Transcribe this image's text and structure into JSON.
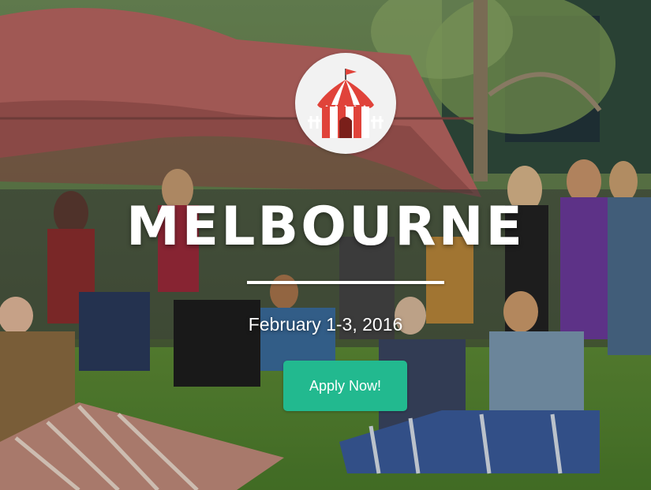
{
  "hero": {
    "title": "MELBOURNE",
    "date": "February 1-3, 2016",
    "cta_label": "Apply Now!",
    "logo_icon": "circus-tent-icon",
    "accent_color": "#22b98f"
  }
}
